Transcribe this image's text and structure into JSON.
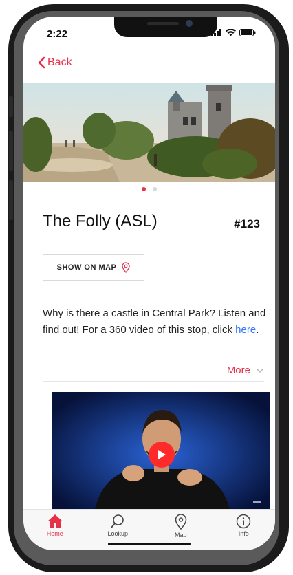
{
  "status_bar": {
    "time": "2:22"
  },
  "nav": {
    "back_label": "Back"
  },
  "gallery": {
    "slide_count": 2,
    "active_index": 0
  },
  "stop": {
    "title": "The Folly  (ASL)",
    "number": "#123",
    "map_button_label": "SHOW ON MAP",
    "description_text": "Why is there a castle in Central Park? Listen and find out! For a 360 video of this stop, click ",
    "description_link": "here",
    "description_end": ".",
    "more_label": "More"
  },
  "tabs": [
    {
      "label": "Home",
      "icon": "home-icon",
      "active": true
    },
    {
      "label": "Lookup",
      "icon": "search-icon",
      "active": false
    },
    {
      "label": "Map",
      "icon": "map-pin-icon",
      "active": false
    },
    {
      "label": "Info",
      "icon": "info-icon",
      "active": false
    }
  ],
  "colors": {
    "accent": "#e8304a",
    "link": "#3478f6",
    "play_button": "#ff2b2b"
  }
}
